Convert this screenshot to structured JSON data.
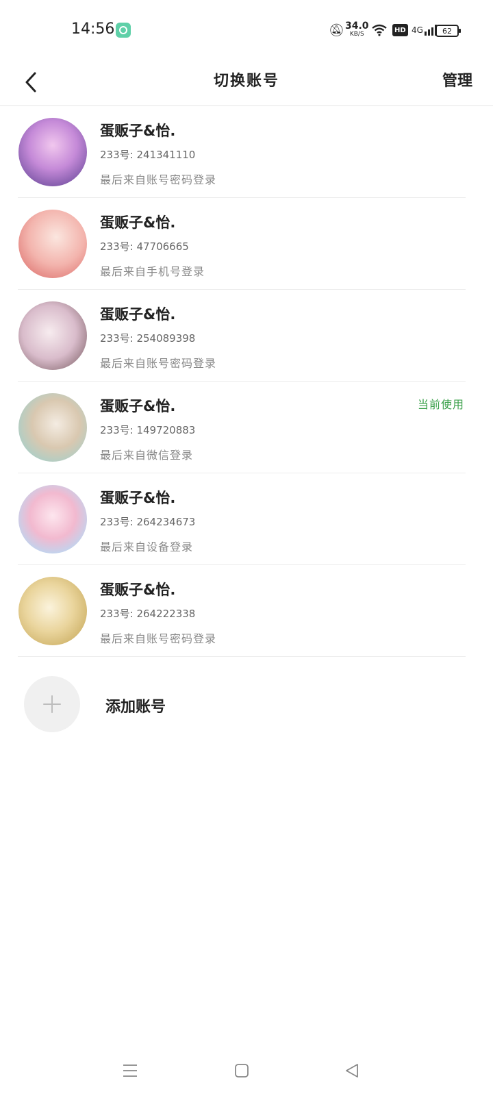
{
  "status_bar": {
    "time": "14:56",
    "net_speed": "34.0",
    "net_unit": "KB/S",
    "hd": "HD",
    "network": "4G",
    "battery": "62"
  },
  "header": {
    "title": "切换账号",
    "manage": "管理"
  },
  "accounts": [
    {
      "name": "蛋贩子&怡.",
      "uid": "233号: 241341110",
      "login": "最后来自账号密码登录",
      "badge": ""
    },
    {
      "name": "蛋贩子&怡.",
      "uid": "233号: 47706665",
      "login": "最后来自手机号登录",
      "badge": ""
    },
    {
      "name": "蛋贩子&怡.",
      "uid": "233号: 254089398",
      "login": "最后来自账号密码登录",
      "badge": ""
    },
    {
      "name": "蛋贩子&怡.",
      "uid": "233号: 149720883",
      "login": "最后来自微信登录",
      "badge": "当前使用"
    },
    {
      "name": "蛋贩子&怡.",
      "uid": "233号: 264234673",
      "login": "最后来自设备登录",
      "badge": ""
    },
    {
      "name": "蛋贩子&怡.",
      "uid": "233号: 264222338",
      "login": "最后来自账号密码登录",
      "badge": ""
    }
  ],
  "add_account": {
    "label": "添加账号"
  },
  "colors": {
    "accent_green": "#3aa04a"
  }
}
